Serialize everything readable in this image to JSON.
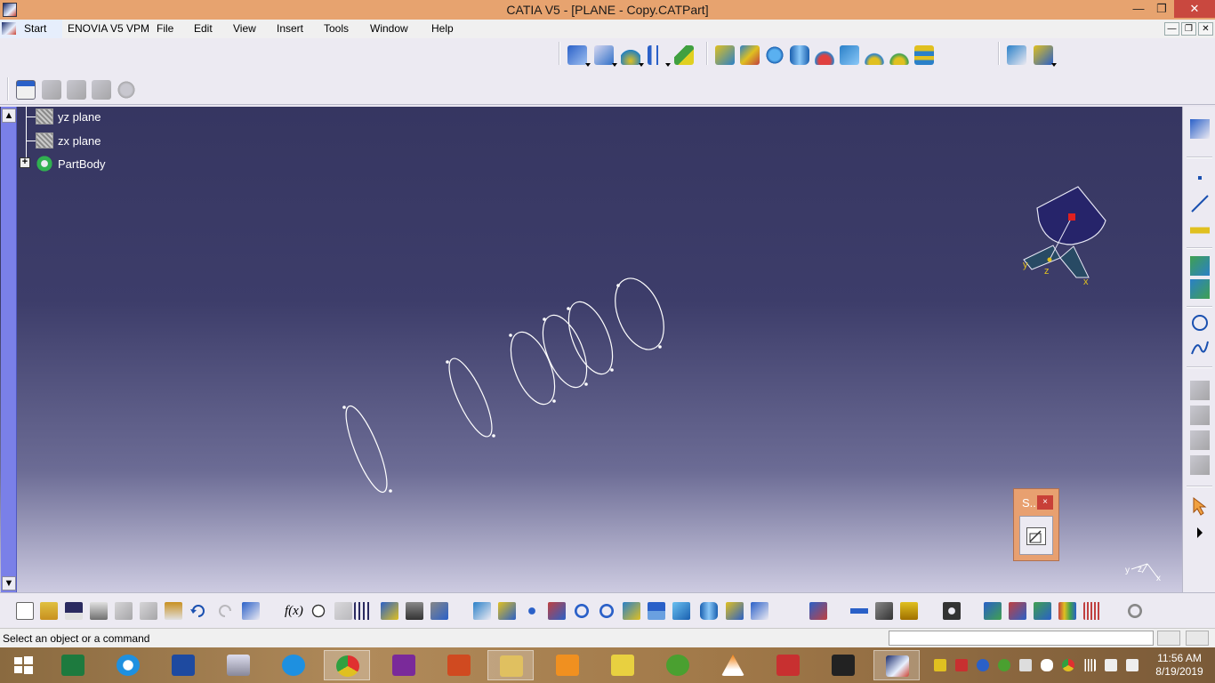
{
  "window": {
    "title": "CATIA V5 - [PLANE - Copy.CATPart]",
    "minimize": "—",
    "maximize": "❐",
    "close": "✕"
  },
  "menu": {
    "start": "Start",
    "items": [
      "ENOVIA V5 VPM",
      "File",
      "Edit",
      "View",
      "Insert",
      "Tools",
      "Window",
      "Help"
    ],
    "mdi_minimize": "—",
    "mdi_restore": "❐",
    "mdi_close": "✕"
  },
  "tree": {
    "nodes": [
      {
        "label": "yz plane",
        "icon": "plane-icon"
      },
      {
        "label": "zx plane",
        "icon": "plane-icon"
      },
      {
        "label": "PartBody",
        "icon": "partbody-icon"
      }
    ]
  },
  "compass": {
    "x": "x",
    "y": "y",
    "z": "z"
  },
  "axis_triad": {
    "x": "x",
    "y": "y",
    "z": "z"
  },
  "sketch_panel": {
    "title": "S..",
    "close": "×",
    "tool_icon": "sketcher-icon"
  },
  "statusbar": {
    "message": "Select an object or a command",
    "command_input": ""
  },
  "colors": {
    "titlebar": "#e7a36f",
    "viewport_top": "#363661",
    "viewport_bottom": "#cdcbe1",
    "tree_bar": "#7a80e8",
    "accent_close": "#c9483f"
  },
  "taskbar": {
    "apps": [
      "windows-start-icon",
      "excel-icon",
      "ie-icon",
      "word-icon",
      "monitor-icon",
      "sync-icon",
      "chrome-icon",
      "picsart-icon",
      "powerpoint-icon",
      "explorer-icon",
      "video-icon",
      "folder-icon",
      "utorrent-icon",
      "vlc-icon",
      "acrobat-icon",
      "media-icon",
      "catia-icon"
    ],
    "time": "11:56 AM",
    "date": "8/19/2019"
  }
}
